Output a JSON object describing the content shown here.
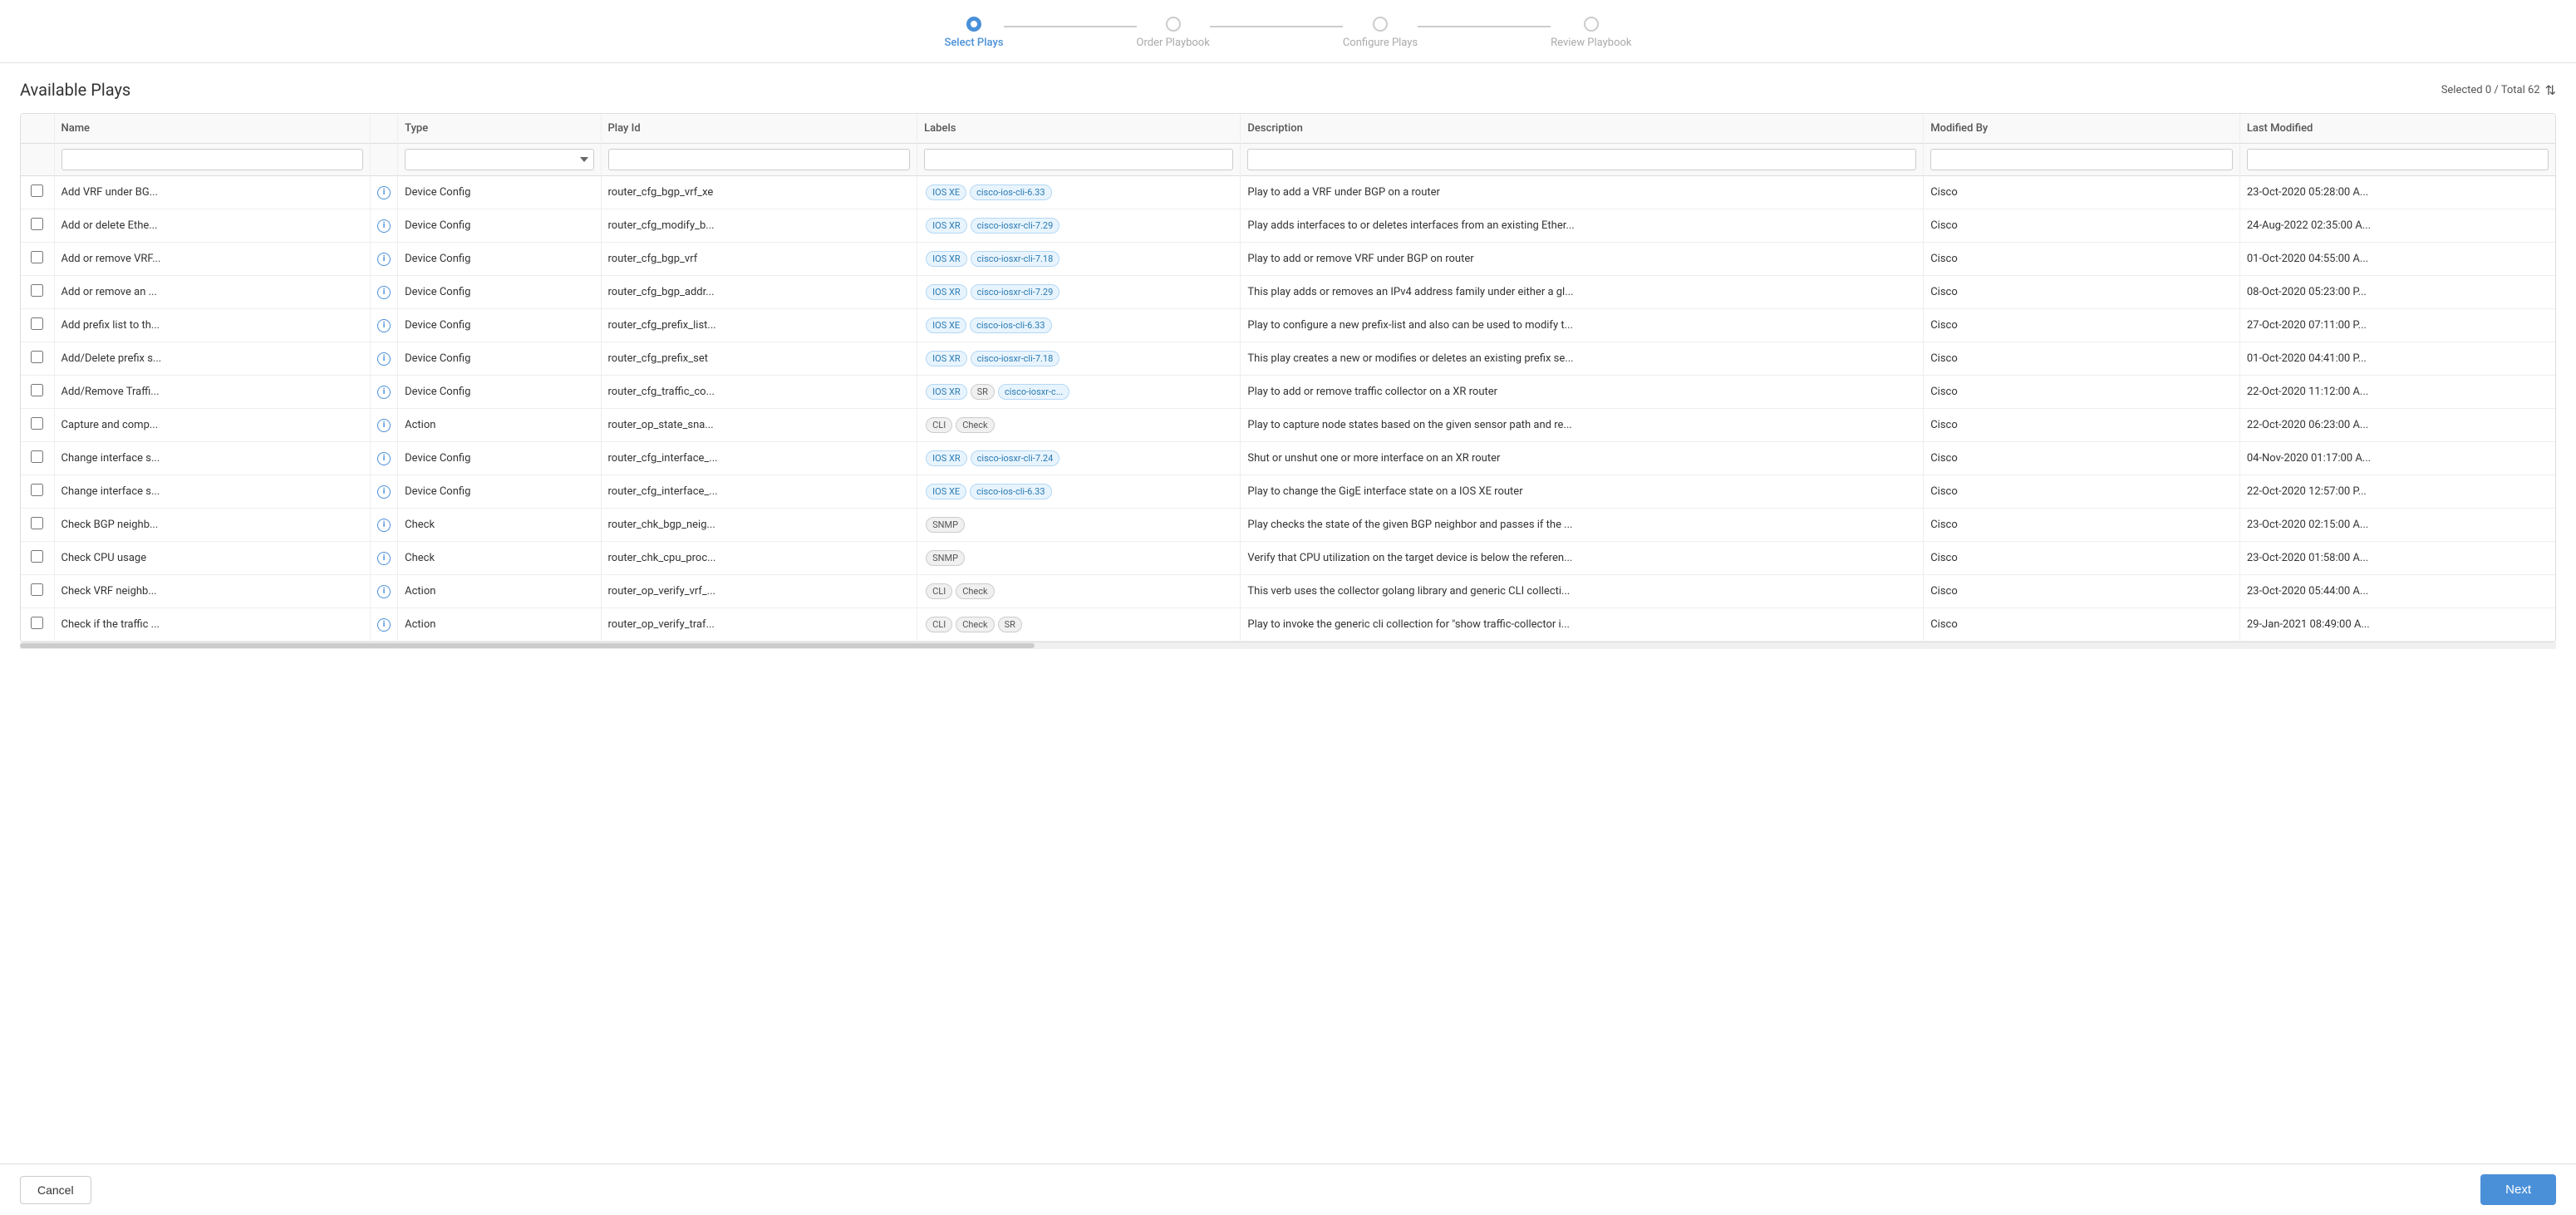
{
  "stepper": {
    "steps": [
      {
        "id": "select-plays",
        "label": "Select Plays",
        "active": true
      },
      {
        "id": "order-playbook",
        "label": "Order Playbook",
        "active": false
      },
      {
        "id": "configure-plays",
        "label": "Configure Plays",
        "active": false
      },
      {
        "id": "review-playbook",
        "label": "Review Playbook",
        "active": false
      }
    ]
  },
  "header": {
    "title": "Available Plays",
    "selection_info": "Selected 0 / Total 62"
  },
  "columns": {
    "name": "Name",
    "type": "Type",
    "play_id": "Play Id",
    "labels": "Labels",
    "description": "Description",
    "modified_by": "Modified By",
    "last_modified": "Last Modified"
  },
  "rows": [
    {
      "name": "Add VRF under BG...",
      "type": "Device Config",
      "play_id": "router_cfg_bgp_vrf_xe",
      "labels": [
        {
          "text": "IOS XE",
          "cls": "ios-xe"
        },
        {
          "text": "cisco-ios-cli-6.33",
          "cls": "ios-xe"
        }
      ],
      "description": "Play to add a VRF under BGP on a router",
      "modified_by": "Cisco",
      "last_modified": "23-Oct-2020 05:28:00 A..."
    },
    {
      "name": "Add or delete Ethe...",
      "type": "Device Config",
      "play_id": "router_cfg_modify_b...",
      "labels": [
        {
          "text": "IOS XR",
          "cls": "ios-xr"
        },
        {
          "text": "cisco-iosxr-cli-7.29",
          "cls": "ios-xr"
        }
      ],
      "description": "Play adds interfaces to or deletes interfaces from an existing Ether...",
      "modified_by": "Cisco",
      "last_modified": "24-Aug-2022 02:35:00 A..."
    },
    {
      "name": "Add or remove VRF...",
      "type": "Device Config",
      "play_id": "router_cfg_bgp_vrf",
      "labels": [
        {
          "text": "IOS XR",
          "cls": "ios-xr"
        },
        {
          "text": "cisco-iosxr-cli-7.18",
          "cls": "ios-xr"
        }
      ],
      "description": "Play to add or remove VRF under BGP on router",
      "modified_by": "Cisco",
      "last_modified": "01-Oct-2020 04:55:00 A..."
    },
    {
      "name": "Add or remove an ...",
      "type": "Device Config",
      "play_id": "router_cfg_bgp_addr...",
      "labels": [
        {
          "text": "IOS XR",
          "cls": "ios-xr"
        },
        {
          "text": "cisco-iosxr-cli-7.29",
          "cls": "ios-xr"
        }
      ],
      "description": "This play adds or removes an IPv4 address family under either a gl...",
      "modified_by": "Cisco",
      "last_modified": "08-Oct-2020 05:23:00 P..."
    },
    {
      "name": "Add prefix list to th...",
      "type": "Device Config",
      "play_id": "router_cfg_prefix_list...",
      "labels": [
        {
          "text": "IOS XE",
          "cls": "ios-xe"
        },
        {
          "text": "cisco-ios-cli-6.33",
          "cls": "ios-xe"
        }
      ],
      "description": "Play to configure a new prefix-list and also can be used to modify t...",
      "modified_by": "Cisco",
      "last_modified": "27-Oct-2020 07:11:00 P..."
    },
    {
      "name": "Add/Delete prefix s...",
      "type": "Device Config",
      "play_id": "router_cfg_prefix_set",
      "labels": [
        {
          "text": "IOS XR",
          "cls": "ios-xr"
        },
        {
          "text": "cisco-iosxr-cli-7.18",
          "cls": "ios-xr"
        }
      ],
      "description": "This play creates a new or modifies or deletes an existing prefix se...",
      "modified_by": "Cisco",
      "last_modified": "01-Oct-2020 04:41:00 P..."
    },
    {
      "name": "Add/Remove Traffi...",
      "type": "Device Config",
      "play_id": "router_cfg_traffic_co...",
      "labels": [
        {
          "text": "IOS XR",
          "cls": "ios-xr"
        },
        {
          "text": "SR",
          "cls": "sr"
        },
        {
          "text": "cisco-iosxr-c...",
          "cls": "ios-xr"
        }
      ],
      "description": "Play to add or remove traffic collector on a XR router",
      "modified_by": "Cisco",
      "last_modified": "22-Oct-2020 11:12:00 A..."
    },
    {
      "name": "Capture and comp...",
      "type": "Action",
      "play_id": "router_op_state_sna...",
      "labels": [
        {
          "text": "CLI",
          "cls": "cli"
        },
        {
          "text": "Check",
          "cls": "check"
        }
      ],
      "description": "Play to capture node states based on the given sensor path and re...",
      "modified_by": "Cisco",
      "last_modified": "22-Oct-2020 06:23:00 A..."
    },
    {
      "name": "Change interface s...",
      "type": "Device Config",
      "play_id": "router_cfg_interface_...",
      "labels": [
        {
          "text": "IOS XR",
          "cls": "ios-xr"
        },
        {
          "text": "cisco-iosxr-cli-7.24",
          "cls": "ios-xr"
        }
      ],
      "description": "Shut or unshut one or more interface on an XR router",
      "modified_by": "Cisco",
      "last_modified": "04-Nov-2020 01:17:00 A..."
    },
    {
      "name": "Change interface s...",
      "type": "Device Config",
      "play_id": "router_cfg_interface_...",
      "labels": [
        {
          "text": "IOS XE",
          "cls": "ios-xe"
        },
        {
          "text": "cisco-ios-cli-6.33",
          "cls": "ios-xe"
        }
      ],
      "description": "Play to change the GigE interface state on a IOS XE router",
      "modified_by": "Cisco",
      "last_modified": "22-Oct-2020 12:57:00 P..."
    },
    {
      "name": "Check BGP neighb...",
      "type": "Check",
      "play_id": "router_chk_bgp_neig...",
      "labels": [
        {
          "text": "SNMP",
          "cls": "snmp"
        }
      ],
      "description": "Play checks the state of the given BGP neighbor and passes if the ...",
      "modified_by": "Cisco",
      "last_modified": "23-Oct-2020 02:15:00 A..."
    },
    {
      "name": "Check CPU usage",
      "type": "Check",
      "play_id": "router_chk_cpu_proc...",
      "labels": [
        {
          "text": "SNMP",
          "cls": "snmp"
        }
      ],
      "description": "Verify that CPU utilization on the target device is below the referen...",
      "modified_by": "Cisco",
      "last_modified": "23-Oct-2020 01:58:00 A..."
    },
    {
      "name": "Check VRF neighb...",
      "type": "Action",
      "play_id": "router_op_verify_vrf_...",
      "labels": [
        {
          "text": "CLI",
          "cls": "cli"
        },
        {
          "text": "Check",
          "cls": "check"
        }
      ],
      "description": "This verb uses the collector golang library and generic CLI collecti...",
      "modified_by": "Cisco",
      "last_modified": "23-Oct-2020 05:44:00 A..."
    },
    {
      "name": "Check if the traffic ...",
      "type": "Action",
      "play_id": "router_op_verify_traf...",
      "labels": [
        {
          "text": "CLI",
          "cls": "cli"
        },
        {
          "text": "Check",
          "cls": "check"
        },
        {
          "text": "SR",
          "cls": "sr"
        }
      ],
      "description": "Play to invoke the generic cli collection for \"show traffic-collector i...",
      "modified_by": "Cisco",
      "last_modified": "29-Jan-2021 08:49:00 A..."
    }
  ],
  "footer": {
    "cancel_label": "Cancel",
    "next_label": "Next"
  }
}
